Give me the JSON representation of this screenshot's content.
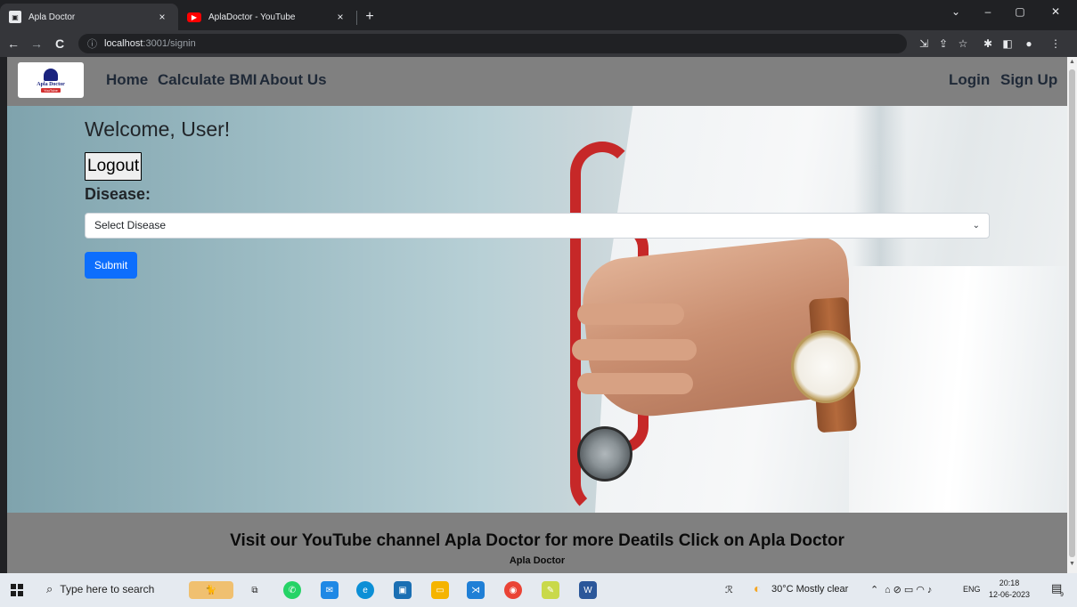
{
  "browser": {
    "tabs": [
      {
        "title": "Apla Doctor",
        "close": "×"
      },
      {
        "title": "AplaDoctor - YouTube",
        "close": "×"
      }
    ],
    "new_tab": "+",
    "window_controls": [
      "⌄",
      "–",
      "▢",
      "✕"
    ],
    "url_host": "localhost",
    "url_path": ":3001/signin",
    "nav": {
      "back": "←",
      "forward": "→",
      "reload": "C"
    }
  },
  "navbar": {
    "logo_text": "Apla Doctor",
    "logo_sub": "YouTube",
    "links": [
      "Home",
      "Calculate BMI",
      "About Us"
    ],
    "right_links": [
      "Login",
      "Sign Up"
    ]
  },
  "main": {
    "welcome": "Welcome, User!",
    "logout_label": "Logout",
    "disease_label": "Disease:",
    "select_value": "Select Disease",
    "submit_label": "Submit"
  },
  "footer": {
    "text": "Visit our YouTube channel Apla Doctor for more Deatils Click on Apla Doctor",
    "link": "Apla Doctor"
  },
  "taskbar": {
    "search_placeholder": "Type here to search",
    "weather": "30°C  Mostly clear",
    "lang": "ENG",
    "time": "20:18",
    "date": "12-06-2023",
    "notification_count": "9"
  },
  "colors": {
    "navbar": "#808080",
    "submit": "#0d6efd",
    "browser_dark": "#202124"
  }
}
